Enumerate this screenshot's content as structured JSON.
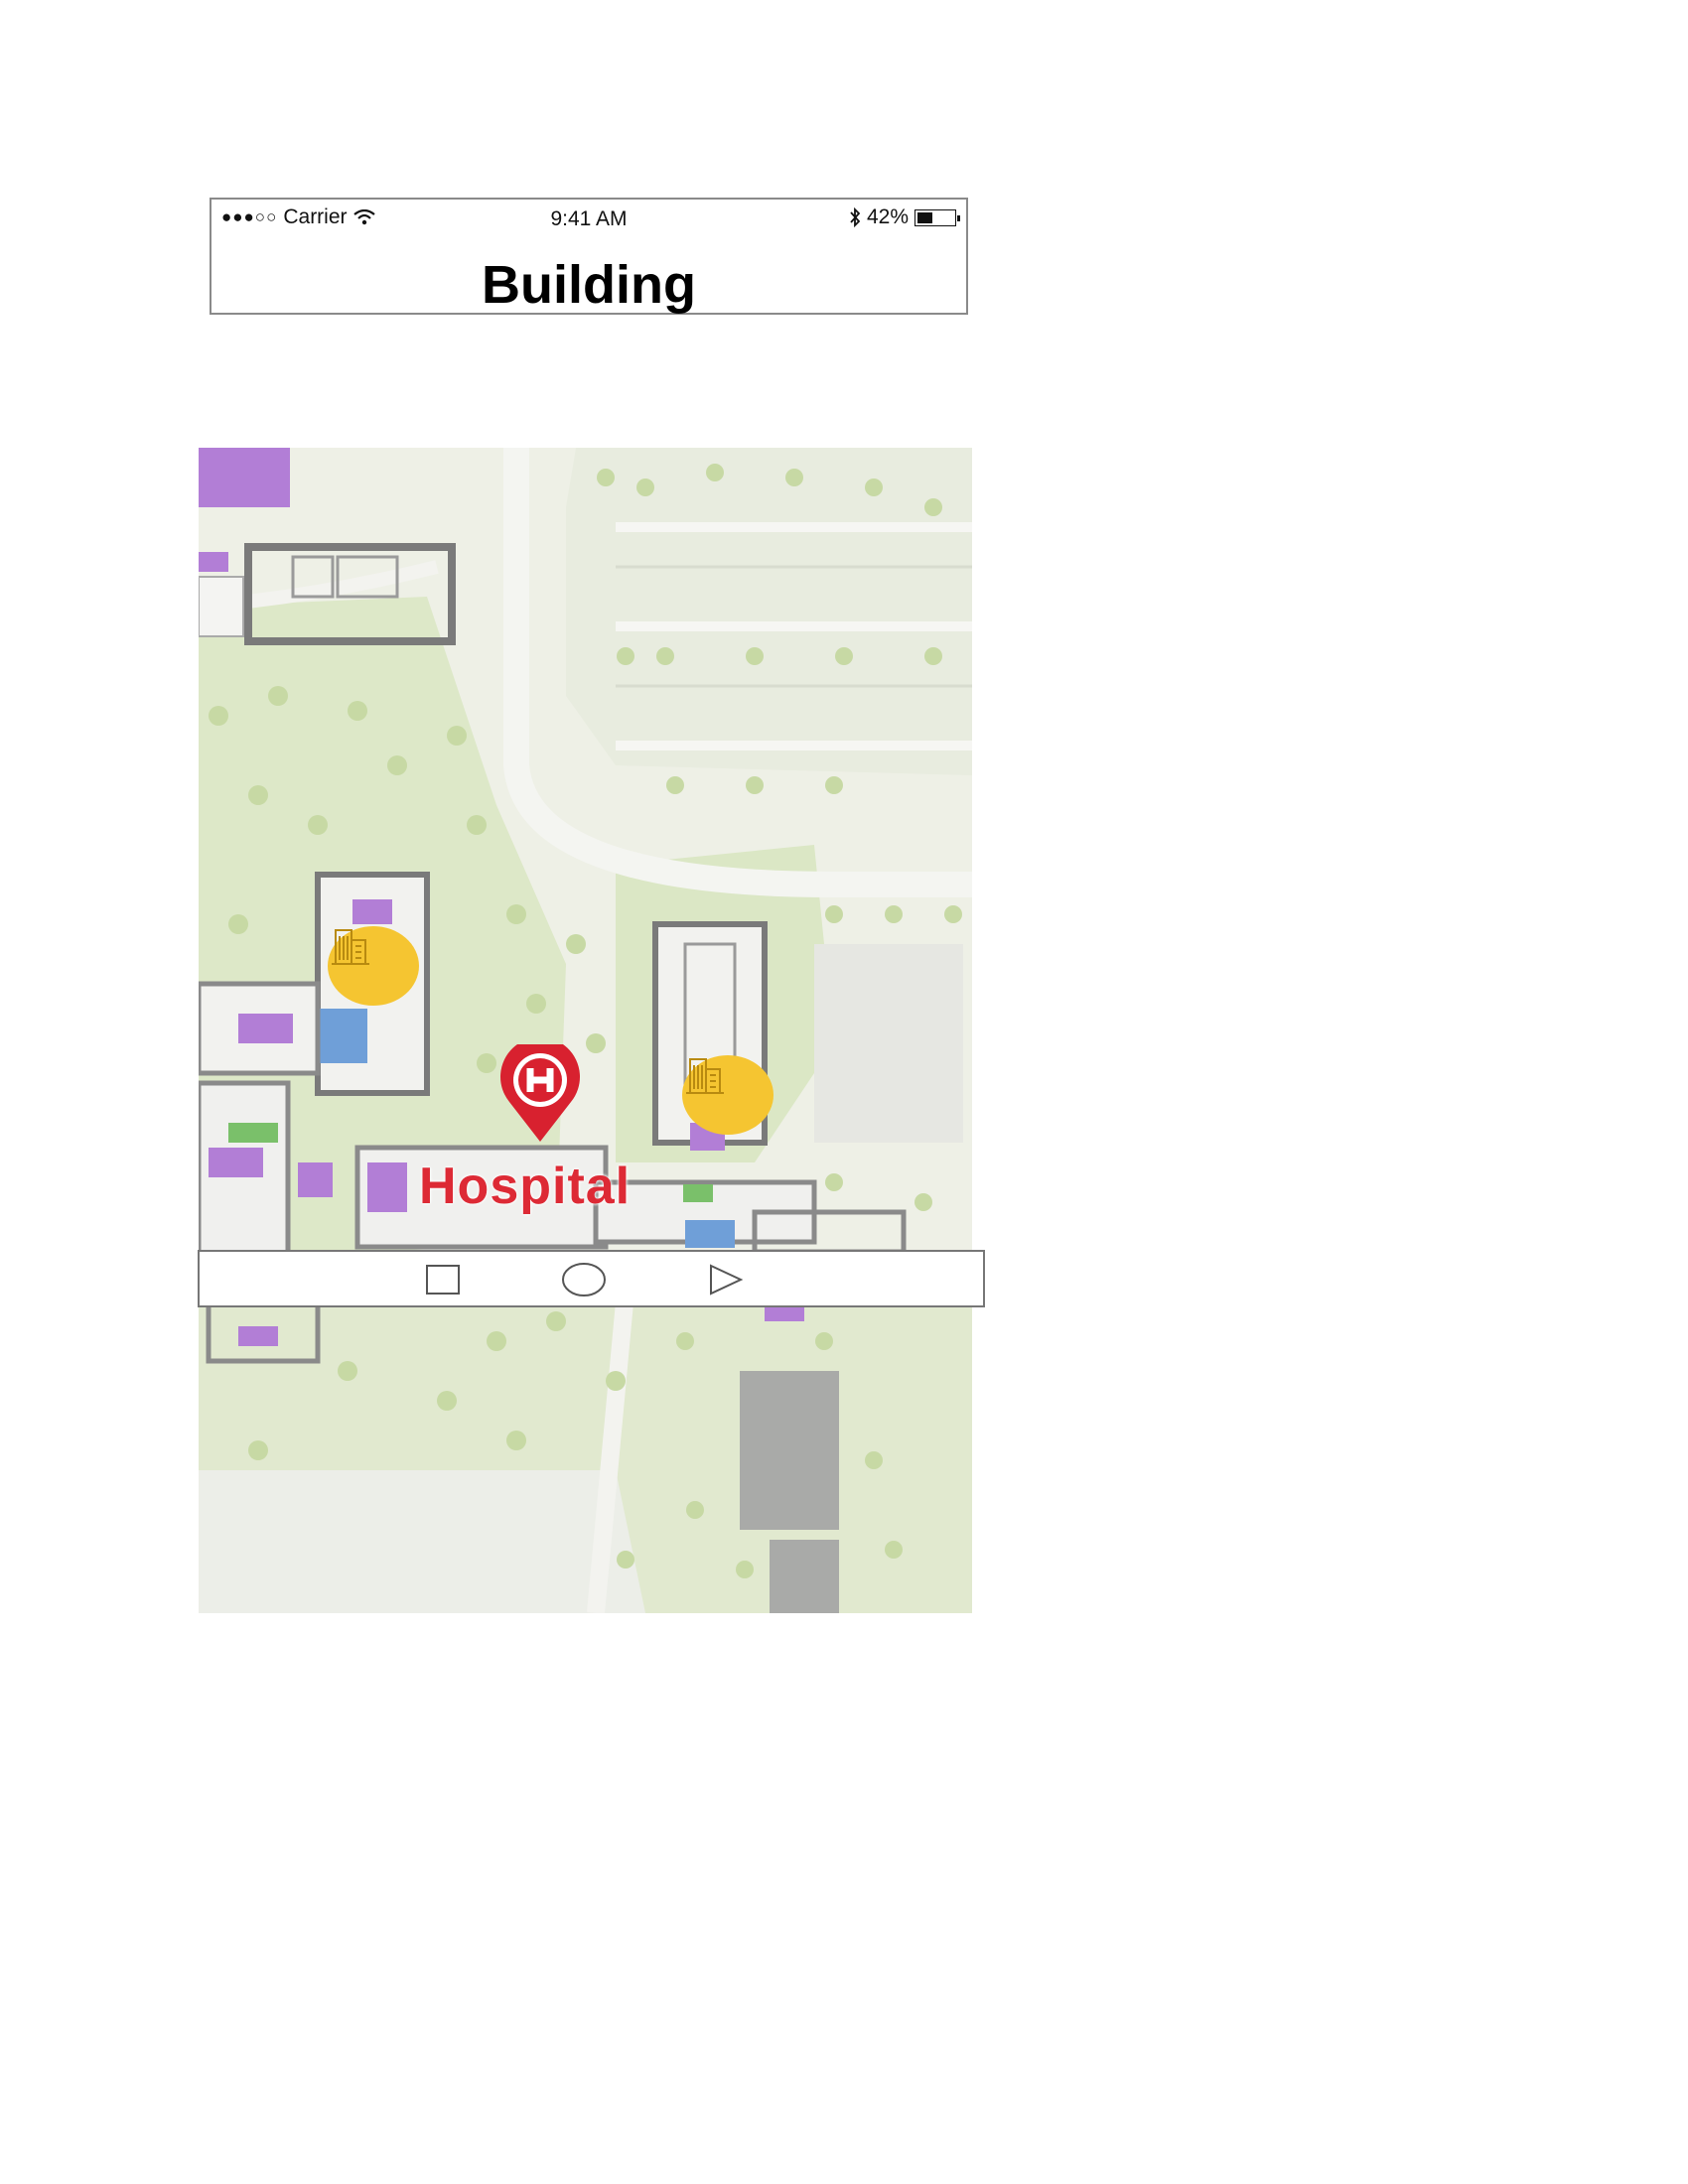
{
  "status_bar": {
    "signal": "●●●○○",
    "carrier": "Carrier",
    "time": "9:41 AM",
    "battery": "42%",
    "battery_level": 0.42,
    "icons": [
      "wifi-icon",
      "bluetooth-icon",
      "battery-icon"
    ]
  },
  "header": {
    "title": "Building"
  },
  "map": {
    "marker_label": "Hospital",
    "markers": [
      {
        "name": "hospital-pin",
        "icon": "hospital-h-icon"
      },
      {
        "name": "building-marker-1",
        "icon": "building-icon"
      },
      {
        "name": "building-marker-2",
        "icon": "building-icon"
      }
    ],
    "colors": {
      "park": "#d9e6c4",
      "building": "#b27ed6",
      "accent": "#f5c531",
      "hospital": "#dd2a35",
      "water": "#6f9fd8"
    }
  },
  "nav_bar": {
    "buttons": [
      "square-recent-apps-icon",
      "circle-home-icon",
      "triangle-back-icon"
    ]
  }
}
